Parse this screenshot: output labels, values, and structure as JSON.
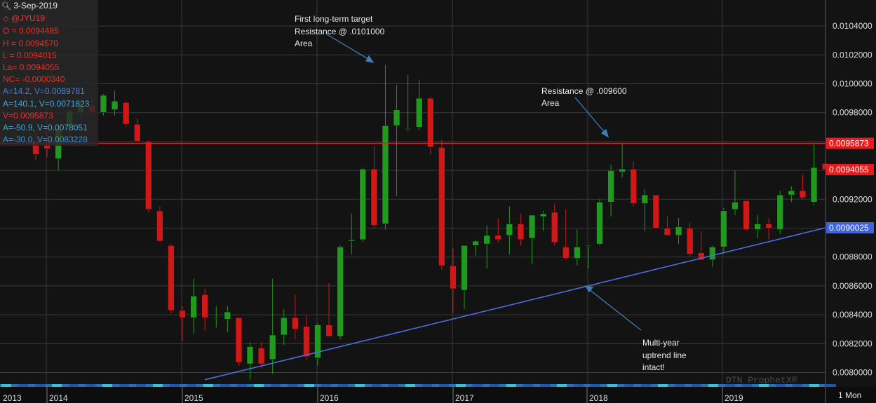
{
  "info_panel": {
    "date": "3-Sep-2019",
    "symbol": "@JYU19",
    "open": "O = 0.0094485",
    "high": "H = 0.0094570",
    "low": "L = 0.0094015",
    "last": "La= 0.0094055",
    "net_change": "NC= -0.0000340",
    "ind1": "A=14.2, V=0.0089781",
    "ind2": "A=140.1, V=0.0071823",
    "ind3": "V=0.0095873",
    "ind4": "A=-50.9, V=0.0078051",
    "ind5": "A=-30.0, V=0.0083228",
    "colors": {
      "symbol": "#e23a3a",
      "ohlc": "#ee2b2b",
      "ind1": "#4c7bd8",
      "ind2": "#3aa9e0",
      "ind3": "#ee2b2b",
      "ind4": "#3aa9e0",
      "ind5": "#3c8fd1"
    }
  },
  "annotations": {
    "first_target": [
      "First long-term target",
      "Resistance @ .0101000",
      "Area"
    ],
    "resistance": [
      "Resistance @ .009600",
      "Area"
    ],
    "uptrend": [
      "Multi-year",
      "uptrend line",
      "intact!"
    ]
  },
  "watermark": "DTN ProphetX®",
  "timeframe": "1 Mon",
  "price_tags": {
    "resistance": "0.0095873",
    "last": "0.0094055",
    "trend": "0.0090025"
  },
  "chart_data": {
    "type": "candlestick",
    "symbol": "@JYU19",
    "interval": "monthly",
    "y_ticks": [
      "0.0080000",
      "0.0082000",
      "0.0084000",
      "0.0086000",
      "0.0088000",
      "0.0090000",
      "0.0092000",
      "0.0094000",
      "0.0096000",
      "0.0098000",
      "0.0100000",
      "0.0102000",
      "0.0104000"
    ],
    "ylim": [
      0.00792,
      0.01058
    ],
    "x_labels": [
      "2013",
      "2014",
      "2015",
      "2016",
      "2017",
      "2018",
      "2019"
    ],
    "resistance_level": 0.0095873,
    "last_price": 0.0094055,
    "trendline": {
      "start": {
        "bar": 15,
        "value": 0.00795
      },
      "end_value_at_axis": 0.0090025
    },
    "colors": {
      "up": "#1f9a1f",
      "down": "#d01818",
      "background": "#131313",
      "grid": "#3a3a3a",
      "resistance": "#e81c1c",
      "trend": "#4b6ee2",
      "axis_text": "#dcdcdc",
      "tag_red": "#e81c1c",
      "tag_blue": "#3f63db"
    },
    "candles": [
      {
        "o": 0.0096,
        "h": 0.00968,
        "l": 0.00947,
        "c": 0.00951
      },
      {
        "o": 0.0096,
        "h": 0.00975,
        "l": 0.00949,
        "c": 0.00955
      },
      {
        "o": 0.00948,
        "h": 0.0097,
        "l": 0.0094,
        "c": 0.00969
      },
      {
        "o": 0.0097,
        "h": 0.00982,
        "l": 0.00965,
        "c": 0.00981
      },
      {
        "o": 0.0098,
        "h": 0.00988,
        "l": 0.00976,
        "c": 0.00985
      },
      {
        "o": 0.00985,
        "h": 0.00991,
        "l": 0.00978,
        "c": 0.0098
      },
      {
        "o": 0.0098,
        "h": 0.00993,
        "l": 0.00978,
        "c": 0.00992
      },
      {
        "o": 0.00982,
        "h": 0.00995,
        "l": 0.00978,
        "c": 0.00988
      },
      {
        "o": 0.00987,
        "h": 0.00988,
        "l": 0.0097,
        "c": 0.00972
      },
      {
        "o": 0.00972,
        "h": 0.00976,
        "l": 0.0096,
        "c": 0.0096
      },
      {
        "o": 0.0096,
        "h": 0.00961,
        "l": 0.00911,
        "c": 0.00913
      },
      {
        "o": 0.00912,
        "h": 0.00915,
        "l": 0.0089,
        "c": 0.00891
      },
      {
        "o": 0.00888,
        "h": 0.00889,
        "l": 0.00841,
        "c": 0.00843
      },
      {
        "o": 0.00843,
        "h": 0.00846,
        "l": 0.00822,
        "c": 0.00838
      },
      {
        "o": 0.00838,
        "h": 0.00865,
        "l": 0.00827,
        "c": 0.00853
      },
      {
        "o": 0.00854,
        "h": 0.00858,
        "l": 0.00829,
        "c": 0.00838
      },
      {
        "o": 0.00838,
        "h": 0.00846,
        "l": 0.00831,
        "c": 0.00838
      },
      {
        "o": 0.00837,
        "h": 0.00846,
        "l": 0.00828,
        "c": 0.00842
      },
      {
        "o": 0.00838,
        "h": 0.00838,
        "l": 0.00805,
        "c": 0.00807
      },
      {
        "o": 0.00806,
        "h": 0.00821,
        "l": 0.00795,
        "c": 0.00818
      },
      {
        "o": 0.00817,
        "h": 0.00821,
        "l": 0.00803,
        "c": 0.00806
      },
      {
        "o": 0.00809,
        "h": 0.00865,
        "l": 0.00799,
        "c": 0.00826
      },
      {
        "o": 0.00826,
        "h": 0.00844,
        "l": 0.00819,
        "c": 0.00838
      },
      {
        "o": 0.00838,
        "h": 0.00854,
        "l": 0.00823,
        "c": 0.0083
      },
      {
        "o": 0.00832,
        "h": 0.0084,
        "l": 0.00809,
        "c": 0.00811
      },
      {
        "o": 0.0081,
        "h": 0.00834,
        "l": 0.00805,
        "c": 0.00833
      },
      {
        "o": 0.00833,
        "h": 0.00862,
        "l": 0.00825,
        "c": 0.00825
      },
      {
        "o": 0.00825,
        "h": 0.00888,
        "l": 0.00823,
        "c": 0.00887
      },
      {
        "o": 0.00891,
        "h": 0.0091,
        "l": 0.00882,
        "c": 0.00892
      },
      {
        "o": 0.00892,
        "h": 0.00942,
        "l": 0.0089,
        "c": 0.00941
      },
      {
        "o": 0.00941,
        "h": 0.00957,
        "l": 0.009,
        "c": 0.00902
      },
      {
        "o": 0.00903,
        "h": 0.01013,
        "l": 0.00899,
        "c": 0.00971
      },
      {
        "o": 0.00971,
        "h": 0.00999,
        "l": 0.00922,
        "c": 0.00982
      },
      {
        "o": 0.00969,
        "h": 0.01006,
        "l": 0.00967,
        "c": 0.00969
      },
      {
        "o": 0.0097,
        "h": 0.01003,
        "l": 0.00968,
        "c": 0.0099
      },
      {
        "o": 0.0099,
        "h": 0.00991,
        "l": 0.00951,
        "c": 0.00956
      },
      {
        "o": 0.00956,
        "h": 0.00961,
        "l": 0.00871,
        "c": 0.00874
      },
      {
        "o": 0.00874,
        "h": 0.00886,
        "l": 0.00841,
        "c": 0.00858
      },
      {
        "o": 0.00857,
        "h": 0.00888,
        "l": 0.00844,
        "c": 0.00888
      },
      {
        "o": 0.00888,
        "h": 0.00892,
        "l": 0.00881,
        "c": 0.00891
      },
      {
        "o": 0.00889,
        "h": 0.00902,
        "l": 0.00872,
        "c": 0.00895
      },
      {
        "o": 0.00895,
        "h": 0.00907,
        "l": 0.0089,
        "c": 0.00892
      },
      {
        "o": 0.00895,
        "h": 0.00915,
        "l": 0.00882,
        "c": 0.00903
      },
      {
        "o": 0.00903,
        "h": 0.0091,
        "l": 0.00888,
        "c": 0.00892
      },
      {
        "o": 0.00893,
        "h": 0.00908,
        "l": 0.00875,
        "c": 0.00909
      },
      {
        "o": 0.00908,
        "h": 0.00912,
        "l": 0.00898,
        "c": 0.0091
      },
      {
        "o": 0.00911,
        "h": 0.00917,
        "l": 0.00888,
        "c": 0.0089
      },
      {
        "o": 0.00887,
        "h": 0.00913,
        "l": 0.00878,
        "c": 0.00879
      },
      {
        "o": 0.00879,
        "h": 0.00899,
        "l": 0.00874,
        "c": 0.00887
      },
      {
        "o": 0.00888,
        "h": 0.00888,
        "l": 0.00872,
        "c": 0.00888
      },
      {
        "o": 0.00889,
        "h": 0.0092,
        "l": 0.00888,
        "c": 0.00918
      },
      {
        "o": 0.00918,
        "h": 0.00944,
        "l": 0.00908,
        "c": 0.0094
      },
      {
        "o": 0.00939,
        "h": 0.00959,
        "l": 0.00935,
        "c": 0.00941
      },
      {
        "o": 0.00941,
        "h": 0.00946,
        "l": 0.00915,
        "c": 0.00917
      },
      {
        "o": 0.00917,
        "h": 0.00927,
        "l": 0.00898,
        "c": 0.00923
      },
      {
        "o": 0.00923,
        "h": 0.00923,
        "l": 0.009,
        "c": 0.009
      },
      {
        "o": 0.009,
        "h": 0.00908,
        "l": 0.00896,
        "c": 0.00895
      },
      {
        "o": 0.00895,
        "h": 0.00907,
        "l": 0.00889,
        "c": 0.00901
      },
      {
        "o": 0.009,
        "h": 0.00904,
        "l": 0.0088,
        "c": 0.00882
      },
      {
        "o": 0.00883,
        "h": 0.00898,
        "l": 0.0088,
        "c": 0.00878
      },
      {
        "o": 0.00878,
        "h": 0.00888,
        "l": 0.00873,
        "c": 0.00887
      },
      {
        "o": 0.00887,
        "h": 0.00914,
        "l": 0.00882,
        "c": 0.00912
      },
      {
        "o": 0.00913,
        "h": 0.0094,
        "l": 0.00909,
        "c": 0.00918
      },
      {
        "o": 0.00919,
        "h": 0.00919,
        "l": 0.00898,
        "c": 0.00899
      },
      {
        "o": 0.00899,
        "h": 0.00909,
        "l": 0.00893,
        "c": 0.00903
      },
      {
        "o": 0.00903,
        "h": 0.00907,
        "l": 0.00892,
        "c": 0.009
      },
      {
        "o": 0.00899,
        "h": 0.00926,
        "l": 0.00896,
        "c": 0.00923
      },
      {
        "o": 0.00923,
        "h": 0.00929,
        "l": 0.00918,
        "c": 0.00926
      },
      {
        "o": 0.00926,
        "h": 0.00937,
        "l": 0.0092,
        "c": 0.00921
      },
      {
        "o": 0.00918,
        "h": 0.00958,
        "l": 0.00916,
        "c": 0.00942
      },
      {
        "o": 0.009448,
        "h": 0.009457,
        "l": 0.009401,
        "c": 0.009406
      }
    ]
  }
}
